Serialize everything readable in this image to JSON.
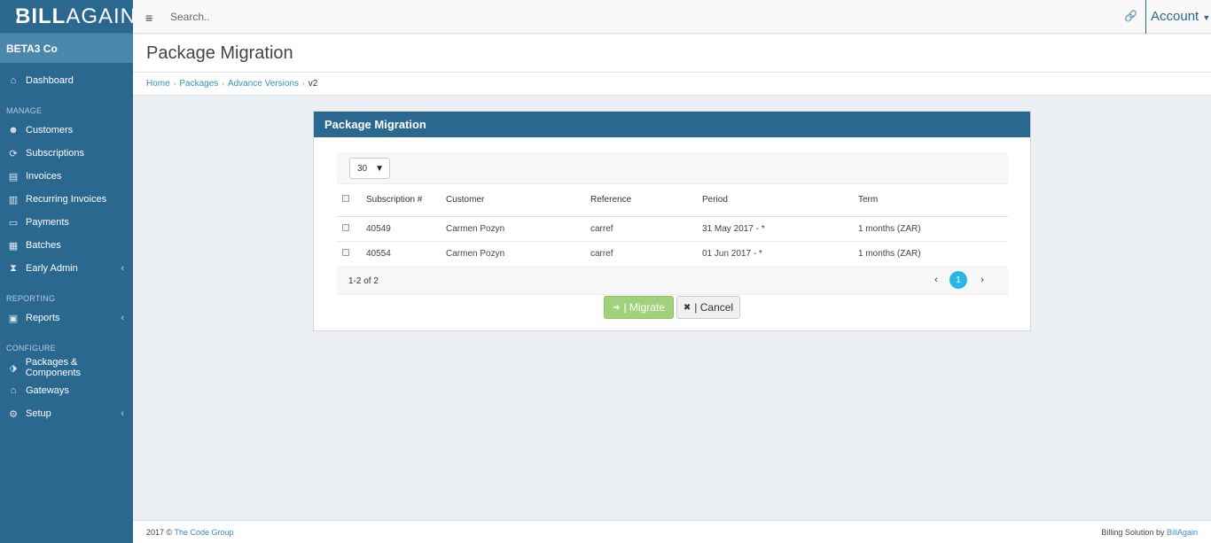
{
  "brand": {
    "part1": "BILL",
    "part2": "AGAIN"
  },
  "company": "BETA3 Co",
  "nav": {
    "dashboard": "Dashboard",
    "section_manage": "MANAGE",
    "customers": "Customers",
    "subscriptions": "Subscriptions",
    "invoices": "Invoices",
    "recurring_invoices": "Recurring Invoices",
    "payments": "Payments",
    "batches": "Batches",
    "early_admin": "Early Admin",
    "section_reporting": "REPORTING",
    "reports": "Reports",
    "section_configure": "CONFIGURE",
    "packages_components": "Packages & Components",
    "gateways": "Gateways",
    "setup": "Setup"
  },
  "topbar": {
    "search_placeholder": "Search..",
    "account": "Account"
  },
  "page": {
    "title": "Package Migration"
  },
  "breadcrumb": {
    "home": "Home",
    "packages": "Packages",
    "advance_versions": "Advance Versions",
    "current": "v2"
  },
  "panel": {
    "title": "Package Migration",
    "page_size": "30",
    "columns": {
      "subscription": "Subscription #",
      "customer": "Customer",
      "reference": "Reference",
      "period": "Period",
      "term": "Term"
    },
    "rows": [
      {
        "subscription": "40549",
        "customer": "Carmen Pozyn",
        "reference": "carref",
        "period": "31 May 2017 - *",
        "term": "1 months (ZAR)"
      },
      {
        "subscription": "40554",
        "customer": "Carmen Pozyn",
        "reference": "carref",
        "period": "01 Jun 2017 - *",
        "term": "1 months (ZAR)"
      }
    ],
    "pager_info": "1-2 of 2",
    "current_page": "1",
    "migrate_label": "| Migrate",
    "cancel_label": "| Cancel"
  },
  "footer": {
    "left_prefix": "2017 ©",
    "left_link": "The Code Group",
    "right_prefix": "Billing Solution by",
    "right_link": "BillAgain"
  },
  "colors": {
    "sidebar": "#2a6890",
    "accent": "#3c8dbc",
    "migrate": "#9fd27b",
    "page_badge": "#29b6e6"
  }
}
